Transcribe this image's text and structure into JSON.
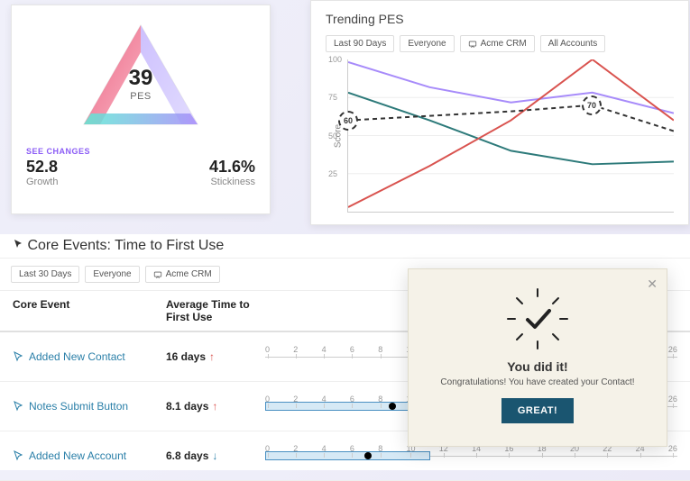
{
  "pes_card": {
    "value": "39",
    "label": "PES",
    "see_changes": "SEE CHANGES",
    "growth_value": "52.8",
    "growth_label": "Growth",
    "stickiness_value": "41.6%",
    "stickiness_label": "Stickiness"
  },
  "trending": {
    "title": "Trending PES",
    "filters": [
      "Last 90 Days",
      "Everyone",
      "Acme CRM",
      "All Accounts"
    ],
    "y_axis_label": "Score",
    "y_ticks": [
      "100",
      "75",
      "50",
      "25"
    ],
    "marker_a": "60",
    "marker_b": "70"
  },
  "chart_data": {
    "type": "line",
    "title": "Trending PES",
    "ylabel": "Score",
    "ylim": [
      0,
      100
    ],
    "x_points": [
      0,
      1,
      2,
      3,
      4
    ],
    "series": [
      {
        "name": "purple",
        "color": "#a78bfa",
        "values": [
          98,
          82,
          72,
          78,
          65
        ]
      },
      {
        "name": "teal",
        "color": "#2d7a7a",
        "values": [
          78,
          60,
          40,
          31,
          33
        ]
      },
      {
        "name": "red",
        "color": "#d9534f",
        "values": [
          3,
          30,
          60,
          100,
          60
        ]
      },
      {
        "name": "dashed",
        "color": "#333333",
        "values": [
          60,
          63,
          66,
          70,
          53
        ],
        "dashed": true,
        "markers": [
          {
            "i": 0,
            "label": "60"
          },
          {
            "i": 3,
            "label": "70"
          }
        ]
      }
    ]
  },
  "core": {
    "title": "Core Events: Time to First Use",
    "filters": [
      "Last 30 Days",
      "Everyone",
      "Acme CRM"
    ],
    "col_event": "Core Event",
    "col_avg": "Average Time to First Use",
    "axis_ticks": [
      "0",
      "2",
      "4",
      "6",
      "8",
      "10",
      "12",
      "14",
      "16",
      "18",
      "20",
      "22",
      "24",
      "26"
    ],
    "rows": [
      {
        "name": "Added New Contact",
        "avg": "16 days",
        "dir": "up"
      },
      {
        "name": "Notes Submit Button",
        "avg": "8.1 days",
        "dir": "up"
      },
      {
        "name": "Added New Account",
        "avg": "6.8 days",
        "dir": "down"
      }
    ]
  },
  "modal": {
    "title": "You did it!",
    "text": "Congratulations! You have created your Contact!",
    "button": "GREAT!"
  }
}
